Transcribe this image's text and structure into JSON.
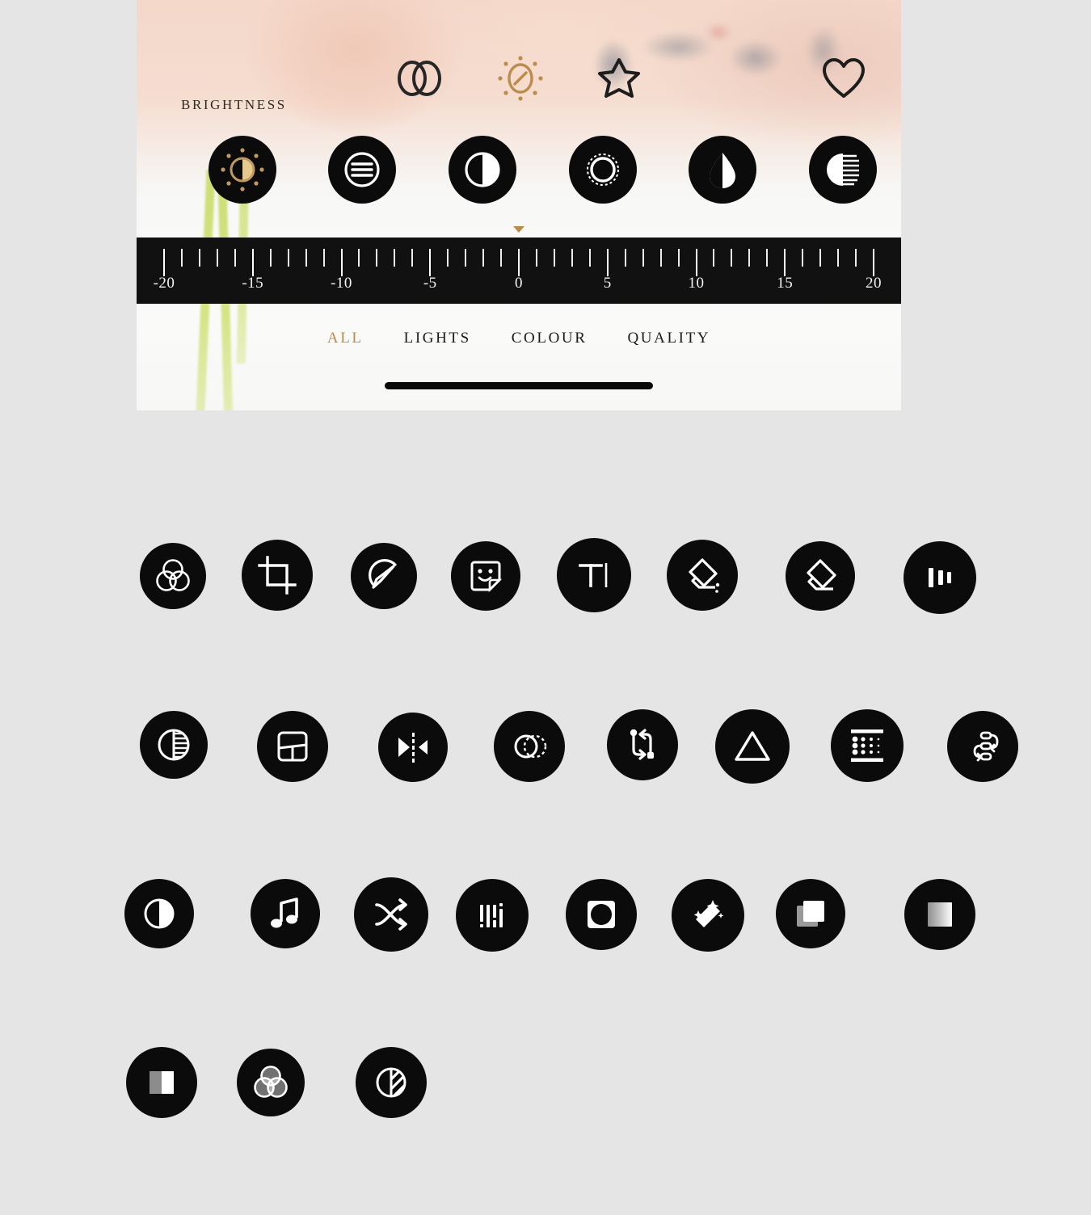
{
  "editor": {
    "section_label": "BRIGHTNESS",
    "accent_gold": "#bb8c4b",
    "panel_dark": "#111111",
    "quick_actions": [
      {
        "name": "blend-circles-icon",
        "label": "Blend",
        "active": false
      },
      {
        "name": "brightness-sun-icon",
        "label": "Brightness",
        "active": true
      },
      {
        "name": "star-icon",
        "label": "Favourite",
        "active": false
      },
      {
        "name": "heart-icon",
        "label": "Like",
        "active": false
      }
    ],
    "adjustments": [
      {
        "name": "brightness-icon",
        "label": "Brightness",
        "selected": true
      },
      {
        "name": "exposure-icon",
        "label": "Exposure",
        "selected": false
      },
      {
        "name": "contrast-icon",
        "label": "Contrast",
        "selected": false
      },
      {
        "name": "vignette-icon",
        "label": "Vignette",
        "selected": false
      },
      {
        "name": "saturation-drop-icon",
        "label": "Saturation",
        "selected": false
      },
      {
        "name": "fade-icon",
        "label": "Fade",
        "selected": false
      }
    ],
    "slider": {
      "value": 0,
      "min": -20,
      "max": 20,
      "major_step": 5,
      "minor_step": 1,
      "labels": [
        "-20",
        "-15",
        "-10",
        "-5",
        "0",
        "5",
        "10",
        "15",
        "20"
      ],
      "label_values": [
        -20,
        -15,
        -10,
        -5,
        0,
        5,
        10,
        15,
        20
      ]
    },
    "tabs": [
      {
        "label": "ALL",
        "active": true
      },
      {
        "label": "LIGHTS",
        "active": false
      },
      {
        "label": "COLOUR",
        "active": false
      },
      {
        "label": "QUALITY",
        "active": false
      }
    ]
  },
  "icon_grid": {
    "rows": [
      [
        {
          "name": "colour-mix-venn-icon",
          "label": "Colour Mix",
          "size": 82
        },
        {
          "name": "crop-icon",
          "label": "Crop",
          "size": 88
        },
        {
          "name": "draw-pencil-icon",
          "label": "Draw",
          "size": 82
        },
        {
          "name": "sticker-icon",
          "label": "Sticker",
          "size": 86
        },
        {
          "name": "text-icon",
          "label": "Text",
          "size": 92
        },
        {
          "name": "eraser-dust-icon",
          "label": "Erase",
          "size": 88
        },
        {
          "name": "eraser-icon",
          "label": "Eraser",
          "size": 86
        },
        {
          "name": "bars-vertical-icon",
          "label": "Levels",
          "size": 90
        }
      ],
      [
        {
          "name": "contrast-lines-icon",
          "label": "Contrast",
          "size": 84
        },
        {
          "name": "collage-layout-icon",
          "label": "Collage",
          "size": 88
        },
        {
          "name": "mirror-flip-icon",
          "label": "Mirror",
          "size": 86
        },
        {
          "name": "duplicate-circles-icon",
          "label": "Duplicate",
          "size": 88
        },
        {
          "name": "swap-arrows-icon",
          "label": "Swap",
          "size": 88
        },
        {
          "name": "triangle-icon",
          "label": "Shape",
          "size": 92
        },
        {
          "name": "halftone-dots-icon",
          "label": "Halftone",
          "size": 90
        },
        {
          "name": "reorder-icon",
          "label": "Reorder",
          "size": 88
        }
      ],
      [
        {
          "name": "contrast-circle-icon",
          "label": "Contrast",
          "size": 86
        },
        {
          "name": "music-note-icon",
          "label": "Music",
          "size": 86
        },
        {
          "name": "shuffle-icon",
          "label": "Shuffle",
          "size": 92
        },
        {
          "name": "equalizer-bars-icon",
          "label": "Equalizer",
          "size": 90
        },
        {
          "name": "mask-square-icon",
          "label": "Mask",
          "size": 88
        },
        {
          "name": "magic-wand-icon",
          "label": "Enhance",
          "size": 90
        },
        {
          "name": "layers-squares-icon",
          "label": "Layers",
          "size": 86
        },
        {
          "name": "gradient-square-icon",
          "label": "Gradient",
          "size": 88
        }
      ],
      [
        {
          "name": "two-tone-square-icon",
          "label": "Tone",
          "size": 88
        },
        {
          "name": "colour-venn-filled-icon",
          "label": "Colour",
          "size": 84
        },
        {
          "name": "diagonal-stripes-circle-icon",
          "label": "Texture",
          "size": 88
        }
      ]
    ]
  }
}
